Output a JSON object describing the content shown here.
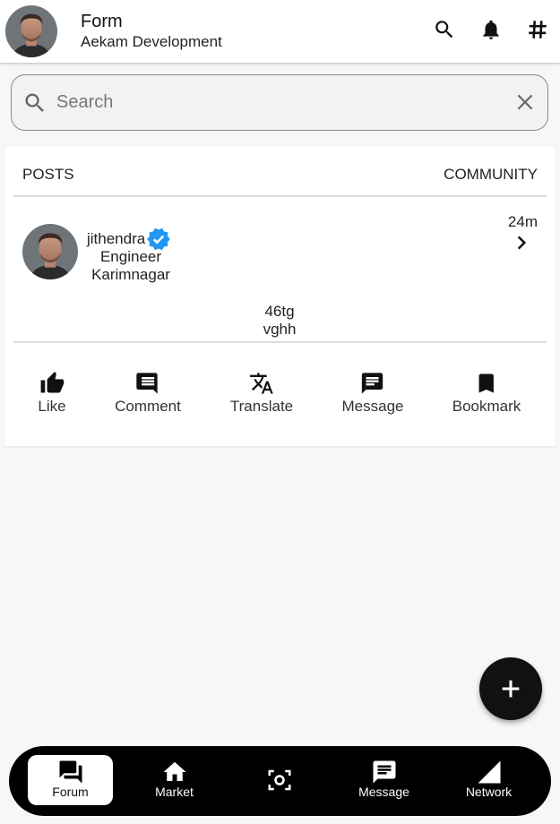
{
  "header": {
    "title": "Form",
    "subtitle": "Aekam Development",
    "actions": [
      {
        "name": "search-icon"
      },
      {
        "name": "notifications-icon"
      },
      {
        "name": "hashtag-icon"
      }
    ]
  },
  "search": {
    "placeholder": "Search",
    "value": ""
  },
  "tabs": {
    "posts": "POSTS",
    "community": "COMMUNITY"
  },
  "post": {
    "username": "jithendra",
    "verified": true,
    "role": "Engineer",
    "location": "Karimnagar",
    "time": "24m",
    "content_line1": "46tg",
    "content_line2": "vghh",
    "actions": [
      {
        "label": "Like",
        "icon": "thumb-up-icon"
      },
      {
        "label": "Comment",
        "icon": "comment-icon"
      },
      {
        "label": "Translate",
        "icon": "translate-icon"
      },
      {
        "label": "Message",
        "icon": "message-icon"
      },
      {
        "label": "Bookmark",
        "icon": "bookmark-icon"
      }
    ]
  },
  "fab": {
    "icon": "add-icon"
  },
  "bottom_nav": {
    "active_index": 0,
    "items": [
      {
        "label": "Forum",
        "icon": "forum-icon"
      },
      {
        "label": "Market",
        "icon": "store-icon"
      },
      {
        "label": "",
        "icon": "scan-icon"
      },
      {
        "label": "Message",
        "icon": "message-icon"
      },
      {
        "label": "Network",
        "icon": "signal-icon"
      }
    ]
  },
  "colors": {
    "verified": "#2196f3",
    "nav_background": "#000000",
    "fab_background": "#111111"
  }
}
